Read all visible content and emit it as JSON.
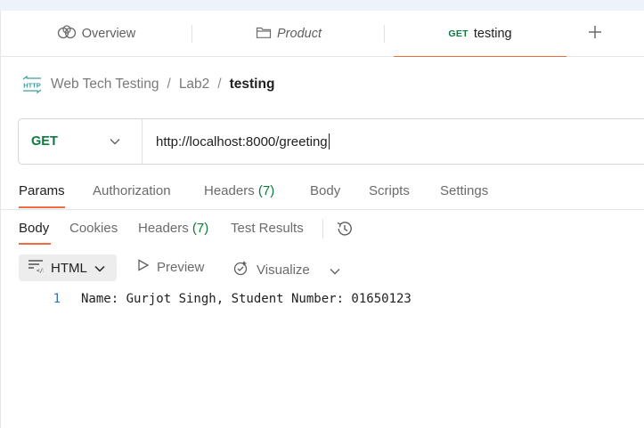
{
  "tabs": [
    {
      "label": "Overview",
      "icon": "team-icon"
    },
    {
      "label": "Product",
      "icon": "folder-icon"
    },
    {
      "method": "GET",
      "label": "testing"
    }
  ],
  "breadcrumb": {
    "icon": "http-icon",
    "icon_text": "HTTP",
    "items": [
      "Web Tech Testing",
      "Lab2",
      "testing"
    ],
    "separator": "/"
  },
  "request": {
    "method": "GET",
    "url": "http://localhost:8000/greeting"
  },
  "request_tabs": {
    "params": "Params",
    "authorization": "Authorization",
    "headers": "Headers",
    "headers_count": "(7)",
    "body": "Body",
    "scripts": "Scripts",
    "settings": "Settings"
  },
  "response_tabs": {
    "body": "Body",
    "cookies": "Cookies",
    "headers": "Headers",
    "headers_count": "(7)",
    "test_results": "Test Results"
  },
  "toolbar": {
    "format": "HTML",
    "preview": "Preview",
    "visualize": "Visualize"
  },
  "response_body": [
    {
      "line": "1",
      "text": "Name: Gurjot Singh, Student Number: 01650123"
    }
  ],
  "colors": {
    "accent": "#f26b3a",
    "method_get": "#0b7a3e",
    "line_number": "#3a6fb0"
  }
}
